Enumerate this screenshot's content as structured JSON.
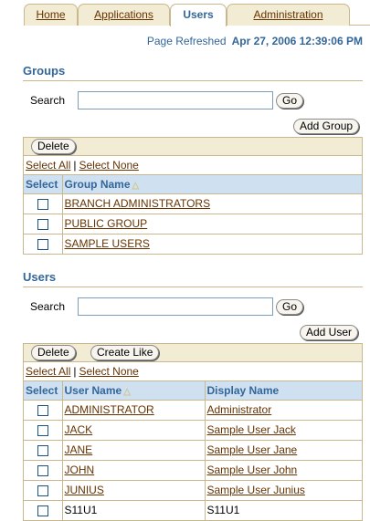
{
  "tabs": [
    {
      "label": "Home",
      "active": false
    },
    {
      "label": "Applications",
      "active": false
    },
    {
      "label": "Users",
      "active": true
    },
    {
      "label": "Administration",
      "active": false
    }
  ],
  "refresh": {
    "label": "Page Refreshed",
    "timestamp": "Apr 27, 2006 12:39:06 PM"
  },
  "groups": {
    "title": "Groups",
    "search_label": "Search",
    "search_value": "",
    "go_label": "Go",
    "add_label": "Add Group",
    "delete_label": "Delete",
    "select_all": "Select All",
    "select_none": "Select None",
    "headers": {
      "select": "Select",
      "name": "Group Name"
    },
    "rows": [
      {
        "name": "BRANCH ADMINISTRATORS"
      },
      {
        "name": "PUBLIC GROUP"
      },
      {
        "name": "SAMPLE USERS"
      }
    ]
  },
  "users": {
    "title": "Users",
    "search_label": "Search",
    "search_value": "",
    "go_label": "Go",
    "add_label": "Add User",
    "delete_label": "Delete",
    "create_like_label": "Create Like",
    "select_all": "Select All",
    "select_none": "Select None",
    "headers": {
      "select": "Select",
      "user": "User Name",
      "display": "Display Name"
    },
    "rows": [
      {
        "user": "ADMINISTRATOR",
        "display": "Administrator",
        "user_link": true,
        "display_link": true
      },
      {
        "user": "JACK",
        "display": "Sample User Jack",
        "user_link": true,
        "display_link": true
      },
      {
        "user": "JANE",
        "display": "Sample User Jane",
        "user_link": true,
        "display_link": true
      },
      {
        "user": "JOHN",
        "display": "Sample User John",
        "user_link": true,
        "display_link": true
      },
      {
        "user": "JUNIUS",
        "display": "Sample User Junius",
        "user_link": true,
        "display_link": true
      },
      {
        "user": "S11U1",
        "display": "S11U1",
        "user_link": false,
        "display_link": false
      }
    ]
  },
  "colors": {
    "link": "#663300",
    "header_text": "#336699",
    "header_bg": "#cfe0f1",
    "tab_bg": "#f2ecd4",
    "border": "#c9b78d"
  },
  "icons": {
    "sort": "sort-ascending-triangle-icon",
    "checkbox": "checkbox-icon"
  }
}
